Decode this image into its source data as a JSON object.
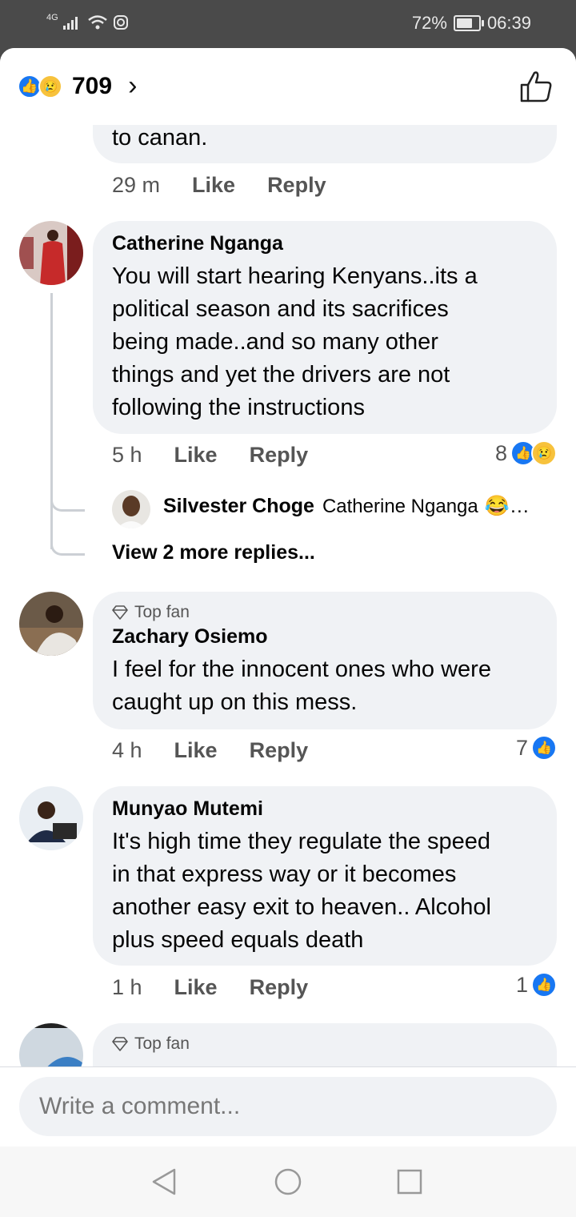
{
  "status_bar": {
    "network": "4G",
    "battery": "72%",
    "battery_level": 0.72,
    "time": "06:39"
  },
  "header": {
    "reaction_count": "709",
    "reactions": [
      "like",
      "sad"
    ]
  },
  "comments": [
    {
      "tail_text": "to canan.",
      "time": "29 m",
      "like": "Like",
      "reply": "Reply"
    },
    {
      "author": "Catherine Nganga",
      "lines": [
        "You will start hearing Kenyans..its a",
        "political season and its sacrifices",
        "being made..and so many other",
        "things and yet the drivers are not",
        "following the instructions"
      ],
      "time": "5 h",
      "like": "Like",
      "reply": "Reply",
      "reaction_count": "8",
      "reply_preview": {
        "author": "Silvester Choge",
        "text": "Catherine Nganga",
        "emoji": "😂",
        "ellipsis": "…"
      },
      "view_more": "View 2 more replies..."
    },
    {
      "badge": "Top fan",
      "author": "Zachary Osiemo",
      "lines": [
        "I feel for the innocent ones who were",
        "caught up on this mess."
      ],
      "time": "4 h",
      "like": "Like",
      "reply": "Reply",
      "reaction_count": "7"
    },
    {
      "author": "Munyao Mutemi",
      "lines": [
        "It's high time they regulate the speed",
        "in that express way or it becomes",
        "another easy exit to heaven.. Alcohol",
        "plus speed equals death"
      ],
      "time": "1 h",
      "like": "Like",
      "reply": "Reply",
      "reaction_count": "1"
    },
    {
      "badge": "Top fan"
    }
  ],
  "composer": {
    "placeholder": "Write a comment..."
  },
  "colors": {
    "accent": "#1877f2",
    "bubble": "#f0f2f5",
    "sad": "#f7c23c"
  }
}
